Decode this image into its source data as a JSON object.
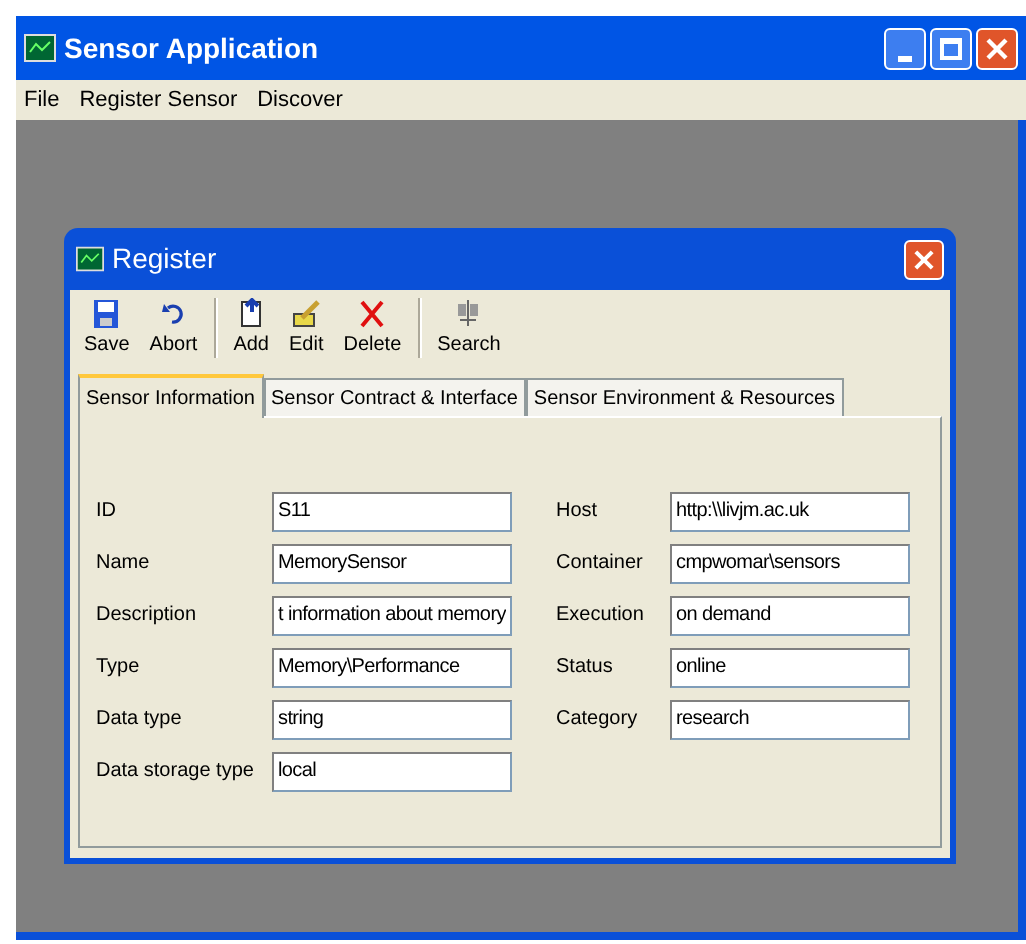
{
  "window": {
    "title": "Sensor Application"
  },
  "menu": [
    "File",
    "Register Sensor",
    "Discover"
  ],
  "dialog": {
    "title": "Register",
    "toolbar": [
      {
        "label": "Save",
        "kind": "save",
        "group_start": false
      },
      {
        "label": "Abort",
        "kind": "abort",
        "group_start": false
      },
      {
        "label": "Add",
        "kind": "add",
        "group_start": true
      },
      {
        "label": "Edit",
        "kind": "edit",
        "group_start": false
      },
      {
        "label": "Delete",
        "kind": "delete",
        "group_start": false
      },
      {
        "label": "Search",
        "kind": "search",
        "group_start": true
      }
    ],
    "tabs": [
      {
        "label": "Sensor Information",
        "selected": true
      },
      {
        "label": "Sensor Contract & Interface",
        "selected": false
      },
      {
        "label": "Sensor Environment & Resources",
        "selected": false
      }
    ],
    "left_fields": [
      {
        "label": "ID",
        "value": "S11"
      },
      {
        "label": "Name",
        "value": "MemorySensor"
      },
      {
        "label": "Description",
        "value": "t information about memory"
      },
      {
        "label": "Type",
        "value": "Memory\\Performance"
      },
      {
        "label": "Data type",
        "value": "string"
      },
      {
        "label": "Data storage type",
        "value": "local"
      }
    ],
    "right_fields": [
      {
        "label": "Host",
        "value": "http:\\\\livjm.ac.uk"
      },
      {
        "label": "Container",
        "value": "cmpwomar\\sensors"
      },
      {
        "label": "Execution",
        "value": "on demand"
      },
      {
        "label": "Status",
        "value": "online"
      },
      {
        "label": "Category",
        "value": "research"
      }
    ]
  }
}
